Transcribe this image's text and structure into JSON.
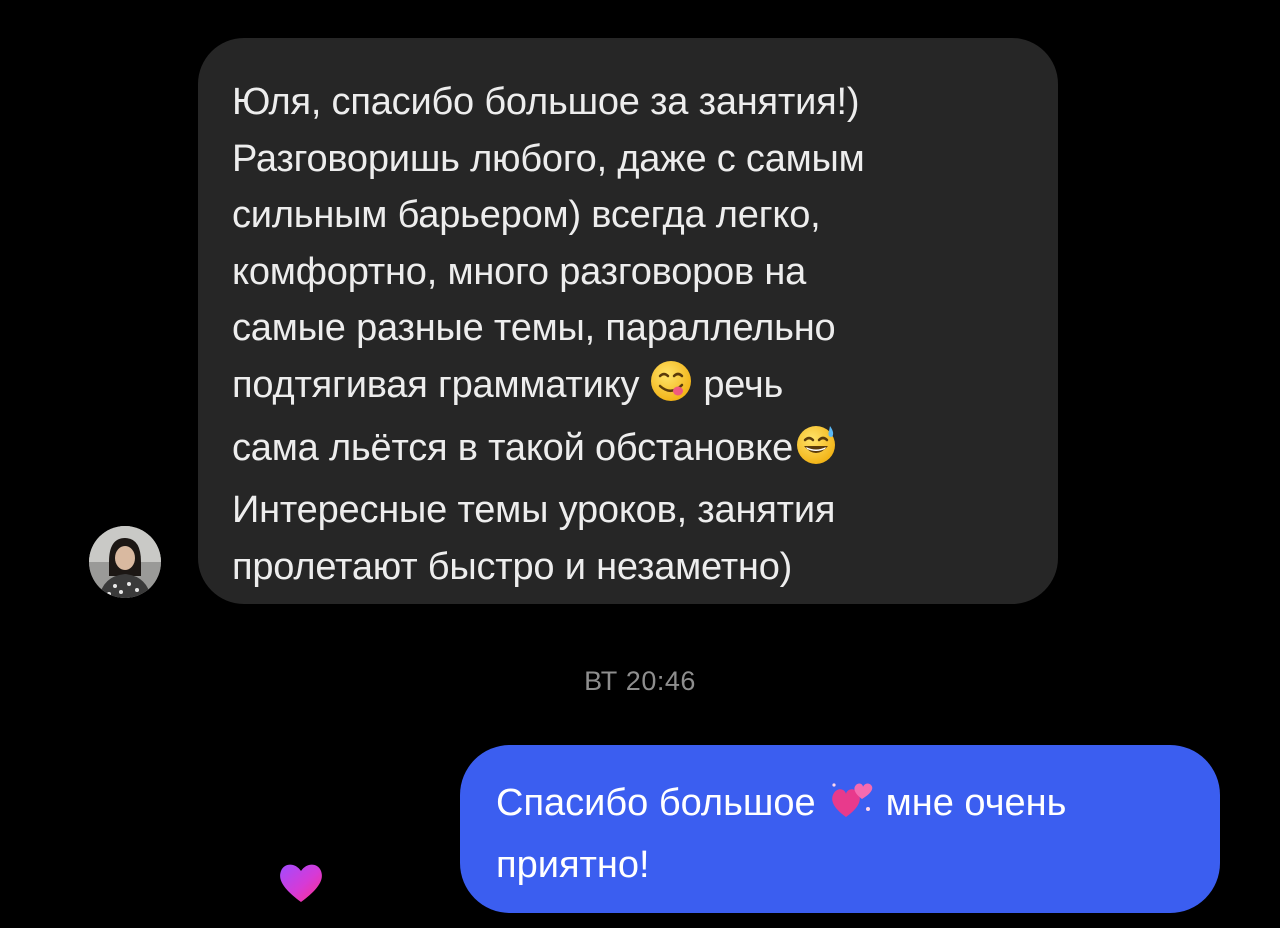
{
  "conversation": {
    "incoming_message": {
      "lines": [
        "Юля, спасибо большое за занятия!)",
        "Разговоришь любого, даже с самым",
        "сильным барьером) всегда легко,",
        "комфортно, много разговоров на",
        "самые разные темы, параллельно",
        "подтягивая грамматику",
        "речь",
        "сама льётся в такой обстановке",
        "Интересные темы уроков, занятия",
        "пролетают быстро и незаметно)"
      ],
      "emojis": [
        "face-savoring-food-icon",
        "grinning-face-with-sweat-icon"
      ]
    },
    "timestamp": "ВТ 20:46",
    "outgoing_message": {
      "lines": [
        "Спасибо большое",
        "мне очень",
        "приятно!"
      ],
      "emoji": "two-hearts-icon"
    },
    "reaction": "purple-heart-icon"
  },
  "colors": {
    "background": "#000000",
    "incoming_bubble": "#262626",
    "outgoing_bubble": "#3b5ef0",
    "timestamp_text": "#8e8e8e"
  }
}
